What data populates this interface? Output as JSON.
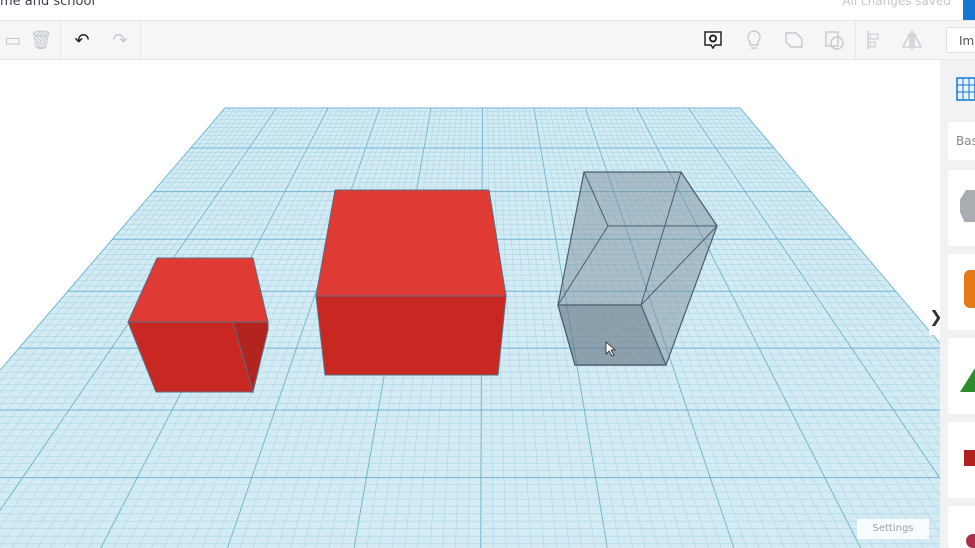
{
  "header": {
    "title": "me and school",
    "save_status": "All changes saved"
  },
  "toolbar": {
    "import_label": "Im",
    "icons": [
      "copy-icon",
      "delete-icon",
      "undo-icon",
      "redo-icon",
      "notes-icon",
      "light-icon",
      "shape-icon",
      "hole-icon",
      "align-icon",
      "mirror-icon"
    ]
  },
  "sidebar": {
    "category_label": "Bas"
  },
  "canvas": {
    "settings_label": "Settings",
    "colors": {
      "plane": "#cfe8f3",
      "grid": "#7cc4de",
      "box": "#d72b27",
      "hole": "#8b9aa6"
    }
  },
  "collapse_icon": "❯"
}
